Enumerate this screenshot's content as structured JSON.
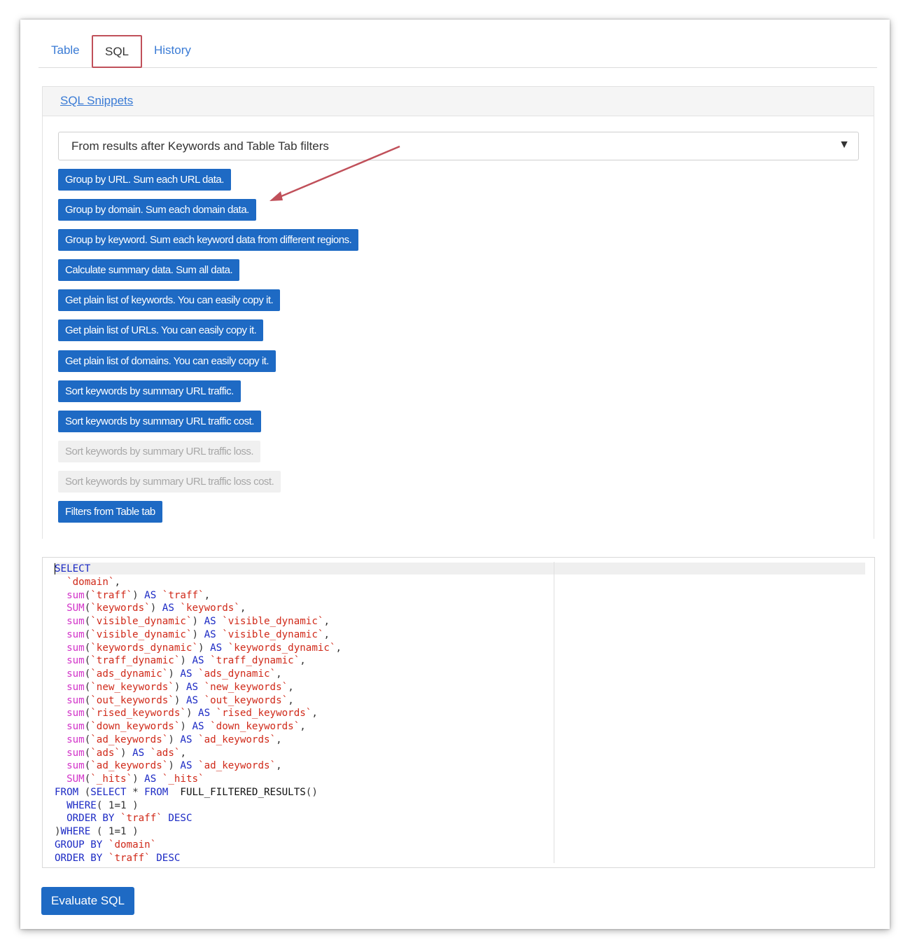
{
  "tabs": {
    "table": "Table",
    "sql": "SQL",
    "history": "History"
  },
  "snippets": {
    "header": "SQL Snippets",
    "select_value": "From results after Keywords and Table Tab filters",
    "buttons": [
      {
        "label": "Group by URL. Sum each URL data.",
        "enabled": true
      },
      {
        "label": "Group by domain. Sum each domain data.",
        "enabled": true
      },
      {
        "label": "Group by keyword. Sum each keyword data from different regions.",
        "enabled": true
      },
      {
        "label": "Calculate summary data. Sum all data.",
        "enabled": true
      },
      {
        "label": "Get plain list of keywords. You can easily copy it.",
        "enabled": true
      },
      {
        "label": "Get plain list of URLs. You can easily copy it.",
        "enabled": true
      },
      {
        "label": "Get plain list of domains. You can easily copy it.",
        "enabled": true
      },
      {
        "label": "Sort keywords by summary URL traffic.",
        "enabled": true
      },
      {
        "label": "Sort keywords by summary URL traffic cost.",
        "enabled": true
      },
      {
        "label": "Sort keywords by summary URL traffic loss.",
        "enabled": false
      },
      {
        "label": "Sort keywords by summary URL traffic loss cost.",
        "enabled": false
      },
      {
        "label": "Filters from Table tab",
        "enabled": true
      }
    ]
  },
  "editor": {
    "lines": [
      "SELECT",
      "  `domain`,",
      "  sum(`traff`) AS `traff`,",
      "  SUM(`keywords`) AS `keywords`,",
      "  sum(`visible_dynamic`) AS `visible_dynamic`,",
      "  sum(`visible_dynamic`) AS `visible_dynamic`,",
      "  sum(`keywords_dynamic`) AS `keywords_dynamic`,",
      "  sum(`traff_dynamic`) AS `traff_dynamic`,",
      "  sum(`ads_dynamic`) AS `ads_dynamic`,",
      "  sum(`new_keywords`) AS `new_keywords`,",
      "  sum(`out_keywords`) AS `out_keywords`,",
      "  sum(`rised_keywords`) AS `rised_keywords`,",
      "  sum(`down_keywords`) AS `down_keywords`,",
      "  sum(`ad_keywords`) AS `ad_keywords`,",
      "  sum(`ads`) AS `ads`,",
      "  sum(`ad_keywords`) AS `ad_keywords`,",
      "  SUM(`_hits`) AS `_hits`",
      "FROM (SELECT * FROM  FULL_FILTERED_RESULTS()",
      "  WHERE( 1=1 )",
      "  ORDER BY `traff` DESC",
      ")WHERE ( 1=1 )",
      "GROUP BY `domain`",
      "ORDER BY `traff` DESC"
    ]
  },
  "actions": {
    "evaluate": "Evaluate SQL"
  },
  "colors": {
    "primary_button": "#1e6ac4",
    "link": "#3a7bd5",
    "sql_keyword": "#1b29c4",
    "sql_function": "#d233c9",
    "sql_identifier": "#d02a1a",
    "annotation": "#c0505a"
  }
}
